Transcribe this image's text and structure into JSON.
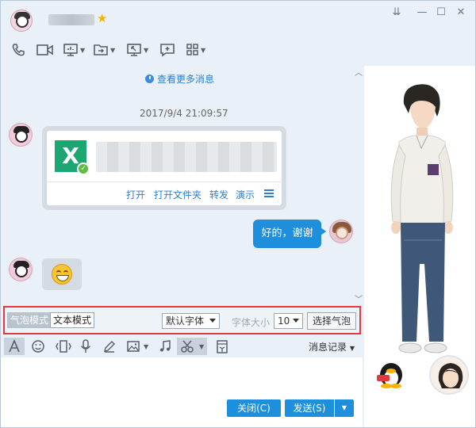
{
  "window": {
    "controls": [
      "⇊",
      "—",
      "☐",
      "✕"
    ]
  },
  "toolbar": {
    "icons": [
      "phone-icon",
      "video-icon",
      "screen-share-icon",
      "file-transfer-icon",
      "remote-desktop-icon",
      "add-chat-icon",
      "apps-grid-icon"
    ]
  },
  "chat": {
    "more_messages": "查看更多消息",
    "timestamp": "2017/9/4 21:09:57",
    "file_card": {
      "actions": [
        "打开",
        "打开文件夹",
        "转发",
        "演示"
      ]
    },
    "my_reply": "好的，谢谢"
  },
  "format_bar": {
    "bubble_mode": "气泡模式",
    "text_mode": "文本模式",
    "font_select": "默认字体",
    "font_size_label": "字体大小",
    "font_size": "10",
    "choose_bubble": "选择气泡"
  },
  "edit_toolbar": {
    "history": "消息记录"
  },
  "buttons": {
    "close": "关闭(C)",
    "send": "发送(S)"
  },
  "colors": {
    "accent": "#1d8fdc",
    "highlight_border": "#e0393e",
    "excel_green": "#1ba672"
  }
}
